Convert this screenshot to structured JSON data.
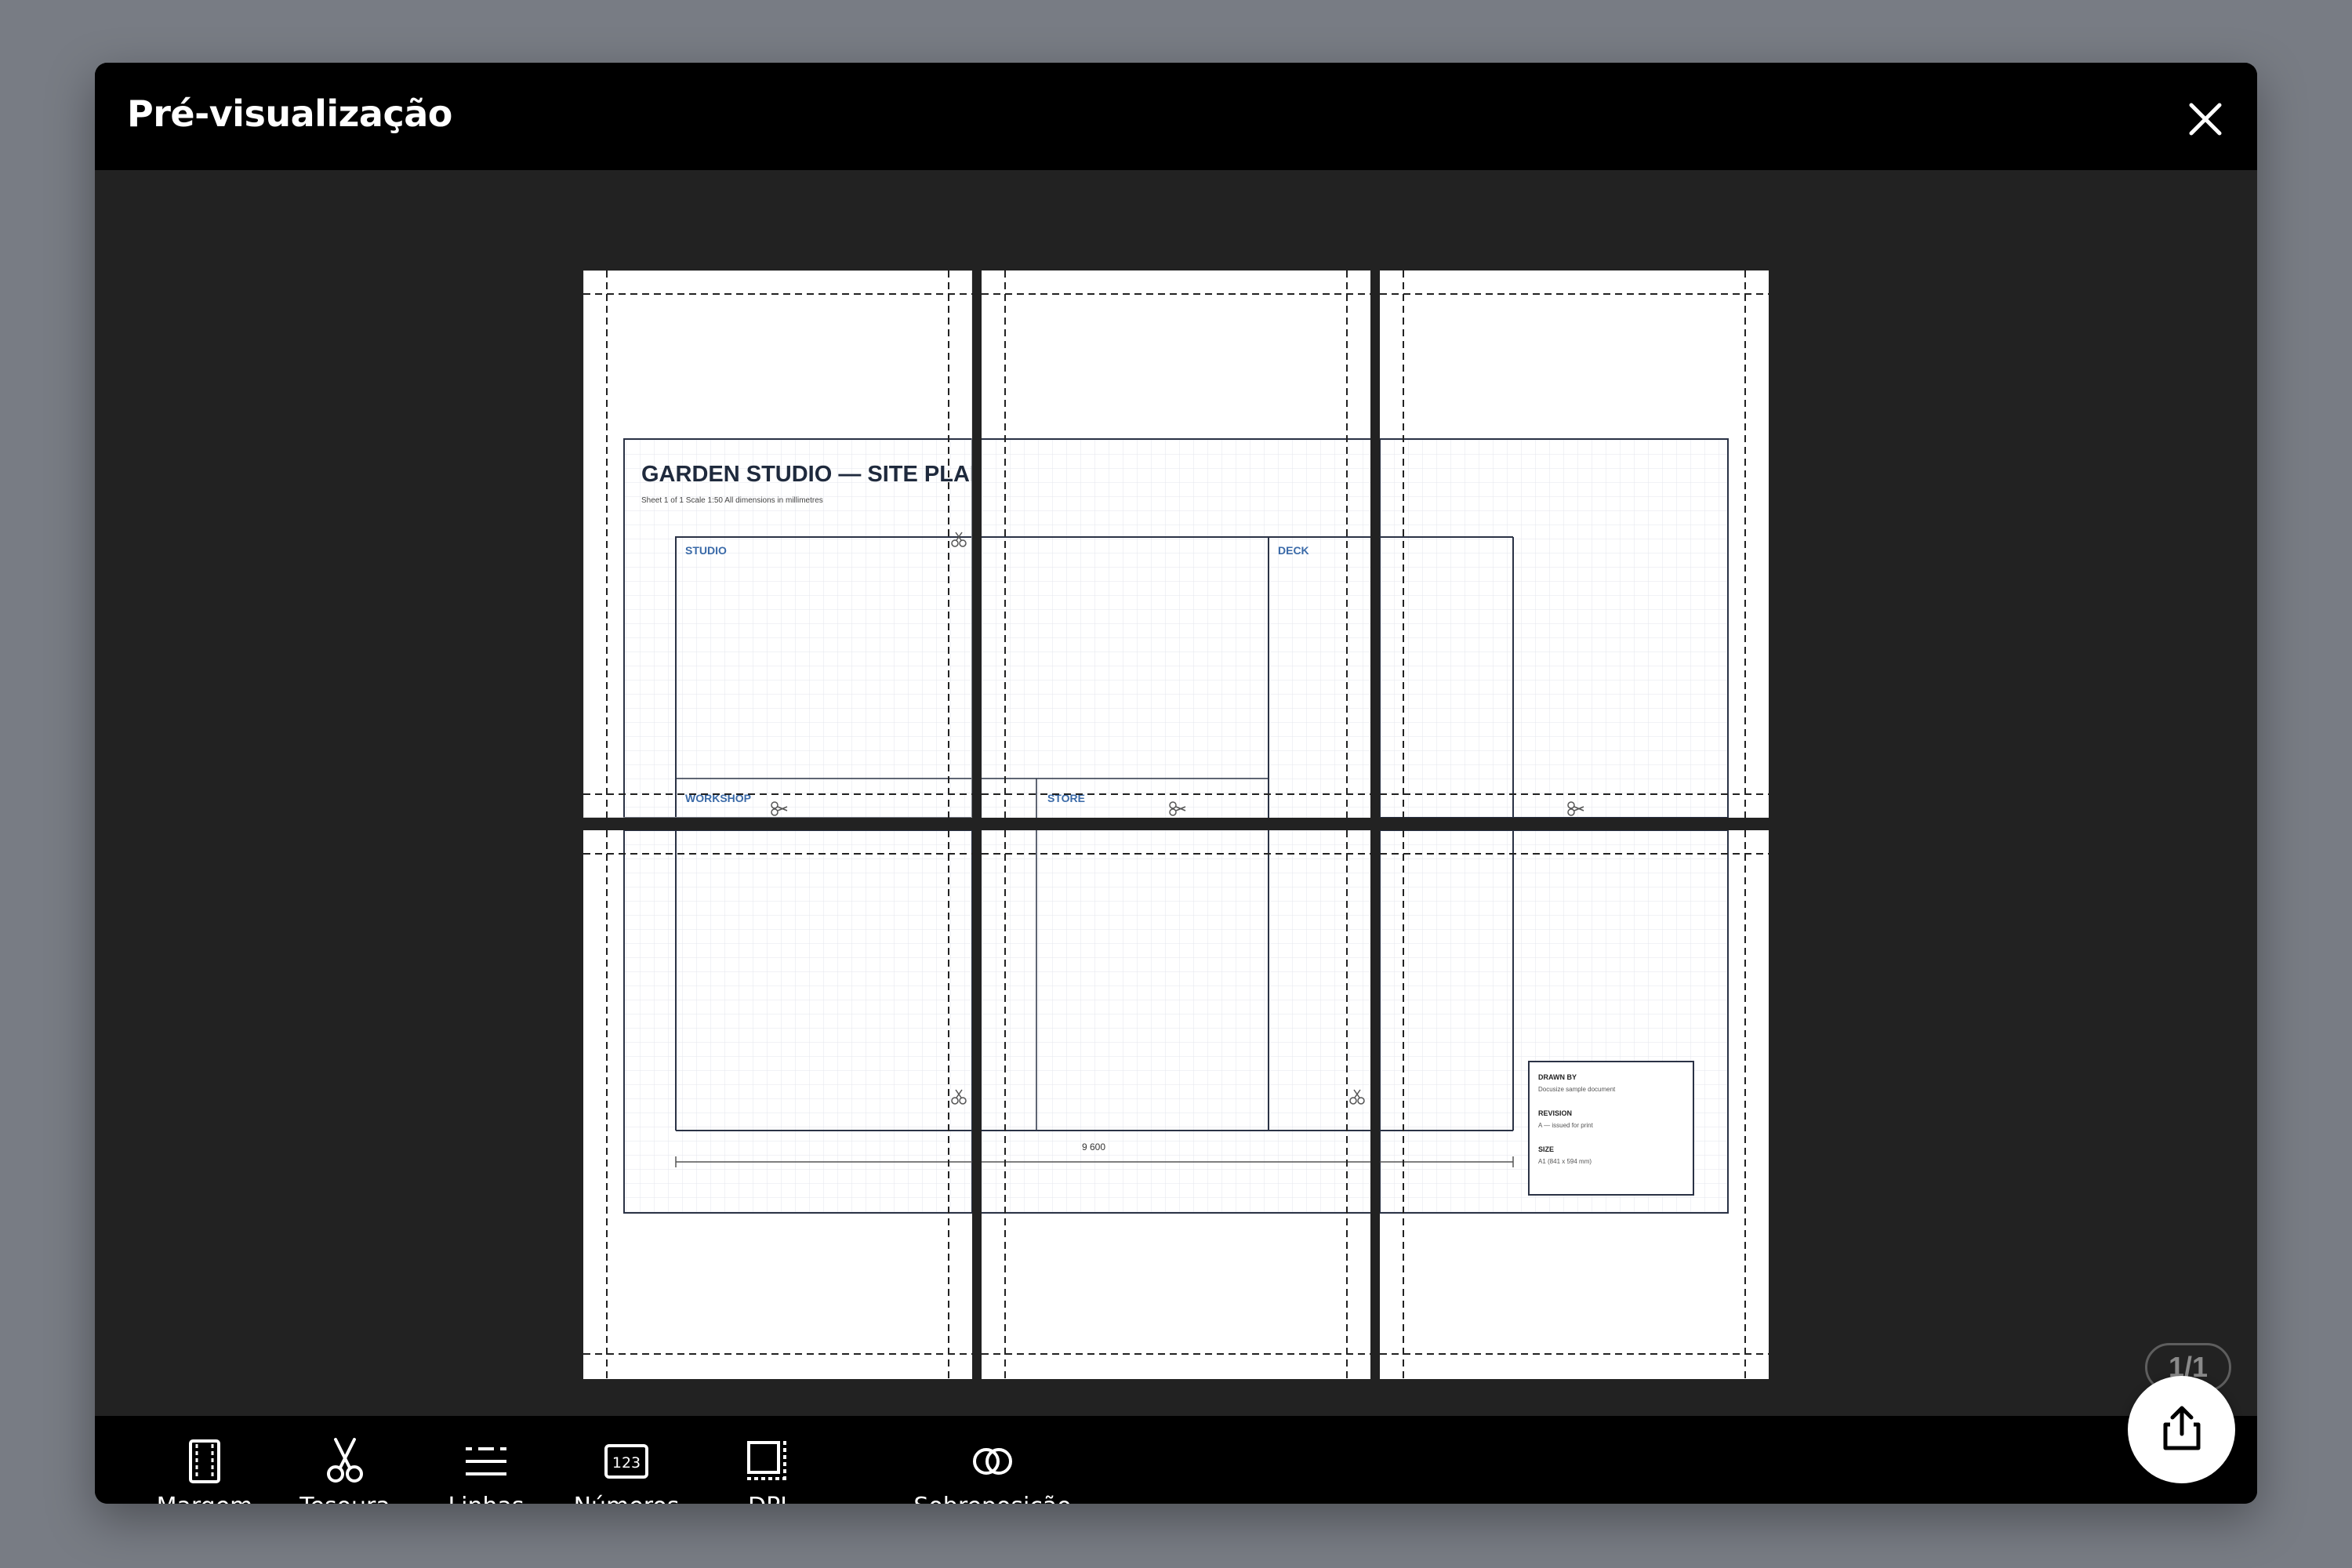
{
  "dialog": {
    "title": "Pré-visualização"
  },
  "preview": {
    "page_counter": "1/1",
    "sheet": {
      "title": "GARDEN STUDIO — SITE PLAN",
      "subtitle": "Sheet 1 of 1     Scale 1:50     All dimensions in millimetres",
      "rooms": [
        "STUDIO",
        "DECK",
        "WORKSHOP",
        "STORE"
      ],
      "dimension": "9 600",
      "title_block": {
        "drawn_by_label": "DRAWN BY",
        "drawn_by_value": "Docusize sample document",
        "revision_label": "REVISION",
        "revision_value": "A — issued for print",
        "size_label": "SIZE",
        "size_value": "A1 (841 x 594 mm)"
      }
    }
  },
  "toolbar": {
    "tools": [
      {
        "label": "Margem",
        "icon": "margin-icon"
      },
      {
        "label": "Tesoura",
        "icon": "scissors-icon"
      },
      {
        "label": "Linhas",
        "icon": "lines-icon"
      },
      {
        "label": "Números",
        "icon": "numbers-icon"
      },
      {
        "label": "DPI",
        "icon": "dpi-icon"
      },
      {
        "label": "Sobreposição",
        "icon": "overlap-icon"
      }
    ],
    "export_icon": "share-icon"
  },
  "colors": {
    "header_bg": "#000000",
    "preview_bg": "#222222",
    "page_bg": "#ffffff",
    "backdrop": "#787c84",
    "accent_label": "#3a6aa8"
  }
}
